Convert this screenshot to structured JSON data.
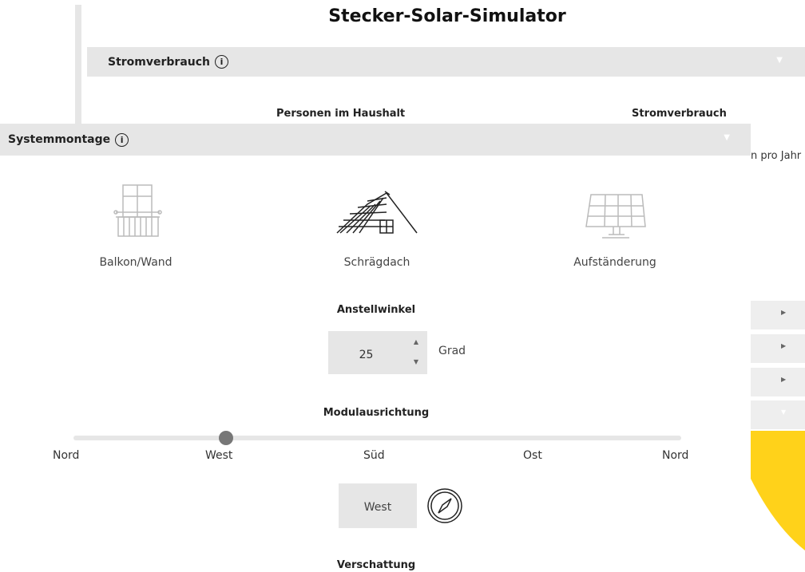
{
  "app": {
    "title": "Stecker-Solar-Simulator"
  },
  "stromverbrauch": {
    "header": "Stromverbrauch",
    "info_icon": "info-icon",
    "col_personen": "Personen im Haushalt",
    "col_verbrauch": "Stromverbrauch",
    "cut_text": "n pro Jahr"
  },
  "systemmontage": {
    "header": "Systemmontage",
    "options": [
      {
        "label": "Balkon/Wand",
        "icon": "balcony-icon",
        "selected": false
      },
      {
        "label": "Schrägdach",
        "icon": "pitched-roof-icon",
        "selected": true
      },
      {
        "label": "Aufständerung",
        "icon": "solar-stand-icon",
        "selected": false
      }
    ],
    "anstellwinkel": {
      "label": "Anstellwinkel",
      "value": "25",
      "unit": "Grad"
    },
    "modulausrichtung": {
      "label": "Modulausrichtung",
      "ticks": [
        "Nord",
        "West",
        "Süd",
        "Ost",
        "Nord"
      ],
      "selected": "West",
      "compass_icon": "compass-icon"
    },
    "verschattung": {
      "label": "Verschattung"
    }
  },
  "colors": {
    "panel_bg": "#e6e6e6",
    "accent_yellow": "#ffd21a",
    "thumb": "#777777"
  }
}
